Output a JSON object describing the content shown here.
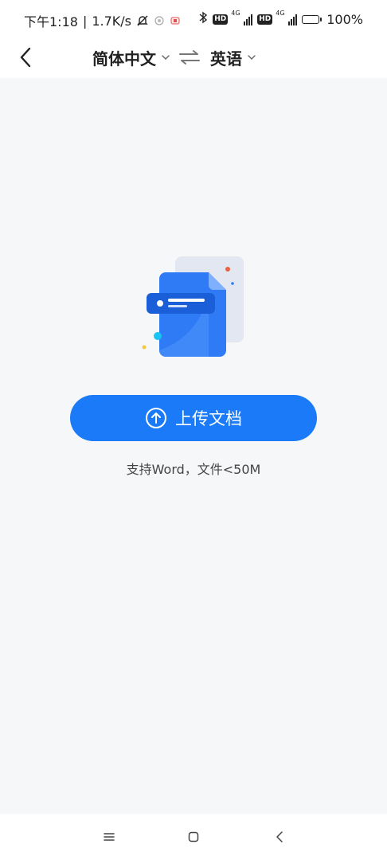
{
  "status_bar": {
    "time": "下午1:18",
    "speed": "1.7K/s",
    "separator": "|",
    "hd1": "HD",
    "net1": "4G",
    "hd2": "HD",
    "net2": "4G",
    "battery_pct": "100%",
    "battery_level": 1.0
  },
  "header": {
    "source_lang": "简体中文",
    "target_lang": "英语"
  },
  "upload": {
    "button_label": "上传文档",
    "hint": "支持Word，文件<50M"
  },
  "colors": {
    "accent": "#1a7af8",
    "background": "#f6f7f8",
    "doc_back": "#e2e7f2",
    "doc_front": "#2f7bf6",
    "doc_label": "#1b5fd8",
    "dot_orange": "#e8643c",
    "dot_cyan": "#19c3f3",
    "dot_yellow": "#f5c642"
  },
  "icons": {
    "back": "chevron-left-icon",
    "dropdown": "chevron-down-icon",
    "swap": "swap-arrows-icon",
    "upload": "upload-arrow-icon",
    "nav_menu": "menu-icon",
    "nav_home": "home-square-icon",
    "nav_back": "back-chevron-icon"
  }
}
